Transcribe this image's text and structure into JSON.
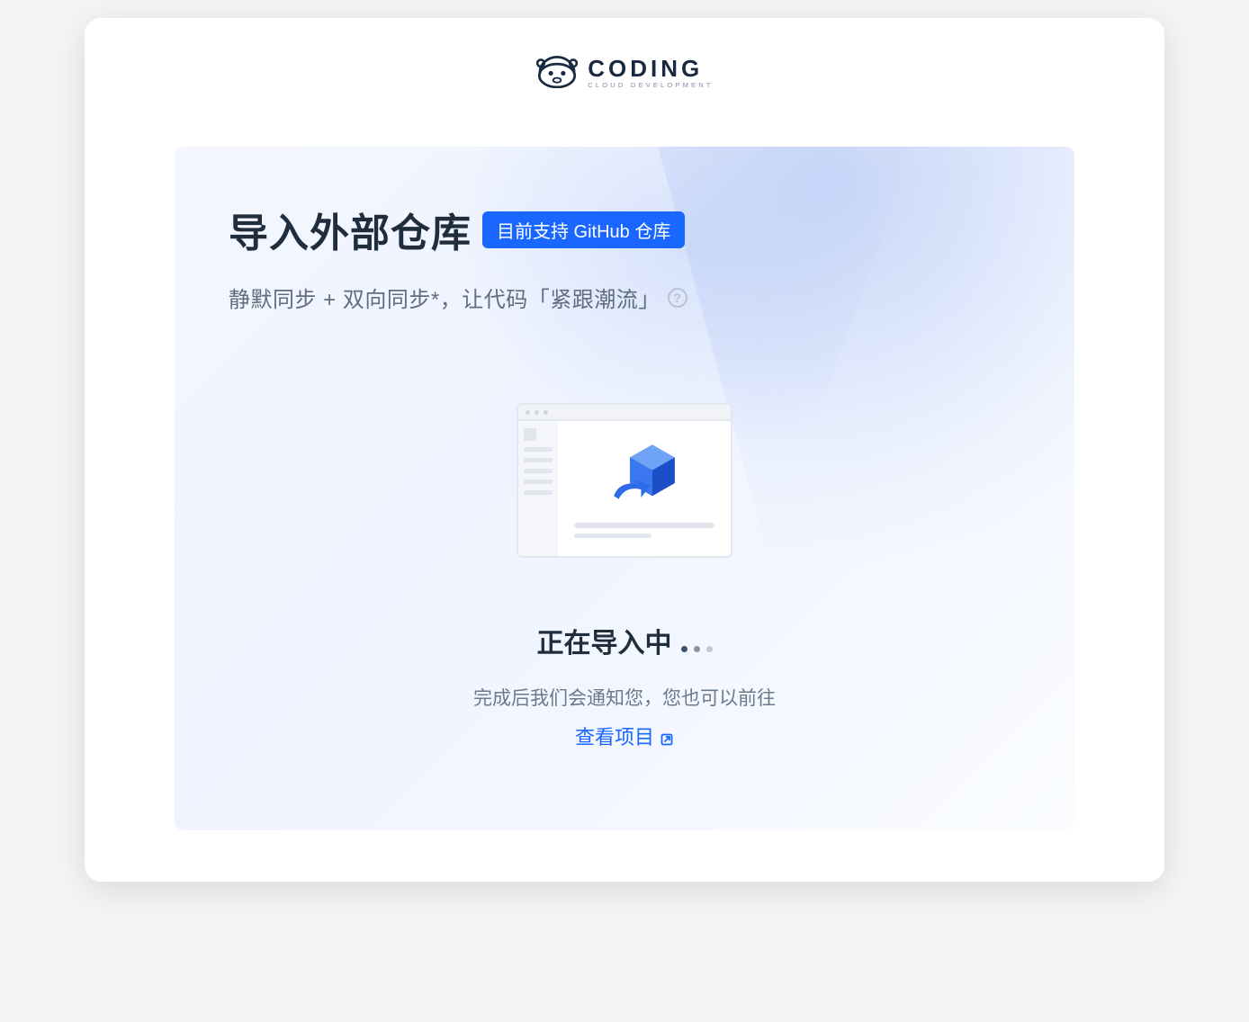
{
  "brand": {
    "name": "CODING",
    "tagline": "CLOUD DEVELOPMENT"
  },
  "header": {
    "title": "导入外部仓库",
    "badge": "目前支持 GitHub 仓库",
    "subtitle": "静默同步 + 双向同步*，让代码「紧跟潮流」"
  },
  "status": {
    "text": "正在导入中"
  },
  "description": "完成后我们会通知您，您也可以前往",
  "link": {
    "label": "查看项目"
  }
}
